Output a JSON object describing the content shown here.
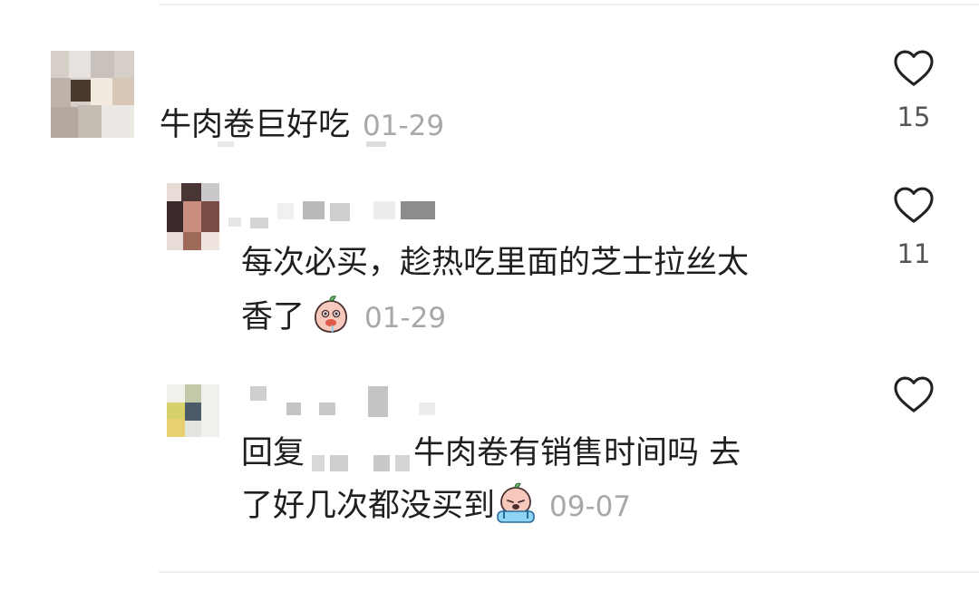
{
  "comments": [
    {
      "text": "牛肉卷巨好吃",
      "date": "01-29",
      "likes": "15",
      "avatar_icon": "pixelated-avatar"
    },
    {
      "line1": "每次必买，趁热吃里面的芝士拉丝太",
      "line2": "香了",
      "date": "01-29",
      "likes": "11",
      "emoji_icon": "peach-drool-emoji",
      "avatar_icon": "pixelated-avatar"
    },
    {
      "prefix": "回复",
      "line1_rest": "牛肉卷有销售时间吗 去",
      "line2": "了好几次都没买到",
      "date": "09-07",
      "likes": "",
      "emoji_icon": "peach-cry-emoji",
      "avatar_icon": "pixelated-avatar"
    }
  ]
}
